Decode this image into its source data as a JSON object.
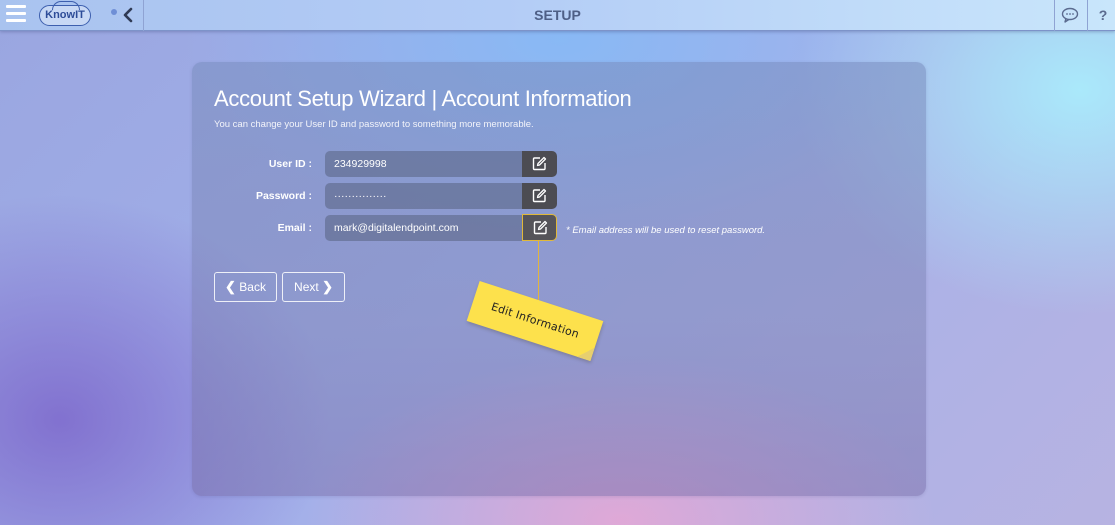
{
  "header": {
    "menu_icon": "hamburger-menu-icon",
    "logo_text": "KnowIT",
    "back_icon": "chevron-left-icon",
    "title": "SETUP",
    "chat_icon": "chat-bubble-icon",
    "help_label": "?"
  },
  "wizard": {
    "title": "Account Setup Wizard | Account Information",
    "subtitle": "You can change your User ID and password to something more memorable.",
    "fields": [
      {
        "label": "User ID :",
        "value": "234929998",
        "edit_icon": "edit-icon"
      },
      {
        "label": "Password :",
        "value": "···············",
        "edit_icon": "edit-icon"
      },
      {
        "label": "Email :",
        "value": "mark@digitalendpoint.com",
        "edit_icon": "edit-icon"
      }
    ],
    "email_note": "* Email address will be used to reset password.",
    "back_label": "Back",
    "next_label": "Next"
  },
  "callout": {
    "text": "Edit Information",
    "color": "#fde14c"
  },
  "colors": {
    "accent_yellow": "#e1b93a",
    "edit_button": "#4c4c52",
    "title_text": "#4e5f86"
  }
}
